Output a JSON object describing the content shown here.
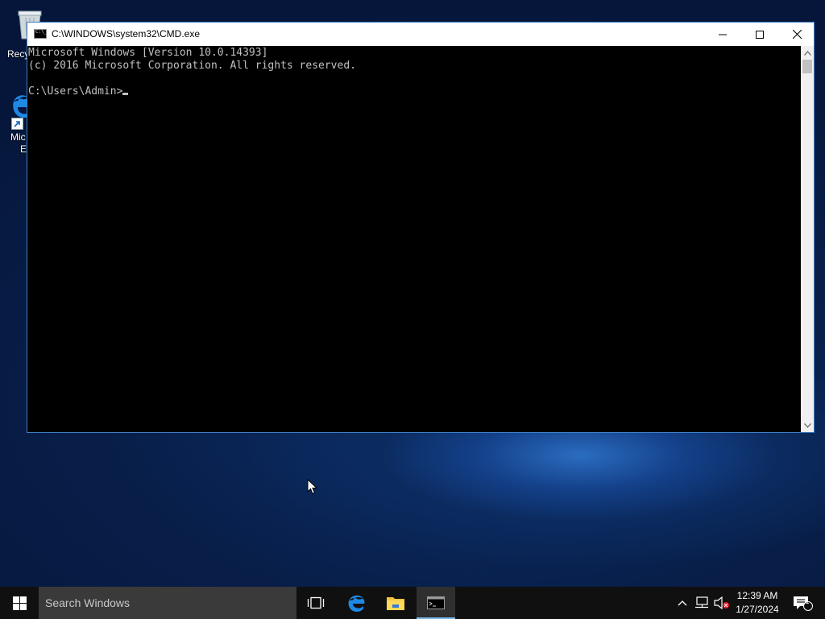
{
  "desktop": {
    "icons": [
      {
        "label": "Recy",
        "icon": "recycle-bin-icon"
      },
      {
        "label_line1": "Mic",
        "label_line2": "E",
        "icon": "microsoft-edge-icon"
      }
    ]
  },
  "window": {
    "title": "C:\\WINDOWS\\system32\\CMD.exe",
    "icon": "cmd-icon",
    "controls": [
      "minimize-icon",
      "maximize-icon",
      "close-icon"
    ]
  },
  "console": {
    "line1": "Microsoft Windows [Version 10.0.14393]",
    "line2": "(c) 2016 Microsoft Corporation. All rights reserved.",
    "prompt": "C:\\Users\\Admin>"
  },
  "taskbar": {
    "search_placeholder": "Search Windows",
    "pinned": [
      "task-view-icon",
      "edge-icon",
      "file-explorer-icon",
      "cmd-icon"
    ],
    "active": "cmd-icon",
    "accent_color": "#76b9ed",
    "tray": {
      "time": "12:39 AM",
      "date": "1/27/2024",
      "notification_count": "1"
    }
  }
}
